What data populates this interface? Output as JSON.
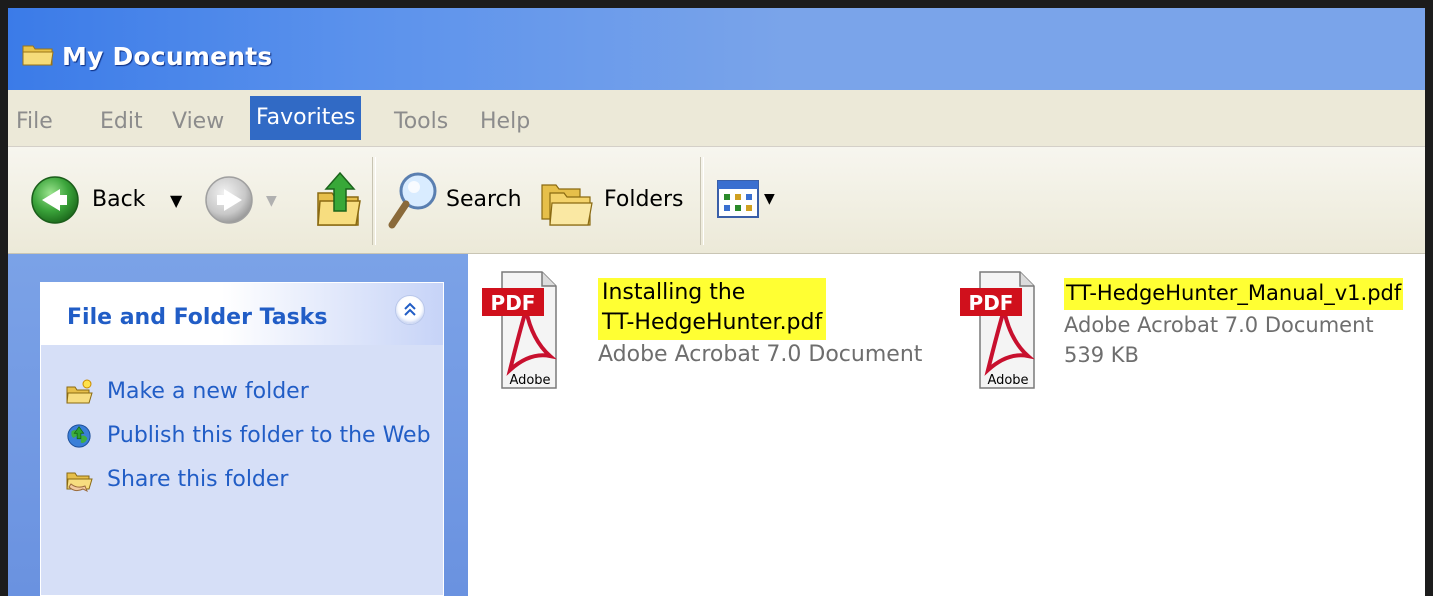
{
  "window": {
    "title": "My Documents"
  },
  "menu": {
    "items": [
      {
        "label": "File"
      },
      {
        "label": "Edit"
      },
      {
        "label": "View"
      },
      {
        "label": "Favorites",
        "active": true
      },
      {
        "label": "Tools"
      },
      {
        "label": "Help"
      }
    ]
  },
  "toolbar": {
    "back_label": "Back",
    "search_label": "Search",
    "folders_label": "Folders"
  },
  "tasks": {
    "title": "File and Folder Tasks",
    "items": [
      {
        "label": "Make a new folder",
        "icon": "new-folder-icon"
      },
      {
        "label": "Publish this folder to the Web",
        "icon": "globe-icon"
      },
      {
        "label": "Share this folder",
        "icon": "share-folder-icon"
      }
    ]
  },
  "files": [
    {
      "name_line1": "Installing the",
      "name_line2": "TT-HedgeHunter.pdf",
      "type": "Adobe Acrobat 7.0 Document",
      "size": ""
    },
    {
      "name_line1": "TT-HedgeHunter_Manual_v1.pdf",
      "name_line2": "",
      "type": "Adobe Acrobat 7.0 Document",
      "size": "539 KB"
    }
  ],
  "icons": {
    "pdf_badge": "PDF",
    "pdf_brand": "Adobe"
  },
  "colors": {
    "title_blue": "#2b6ee6",
    "menu_active": "#316ac5",
    "task_link": "#215dc6",
    "highlight": "#ffff33"
  }
}
